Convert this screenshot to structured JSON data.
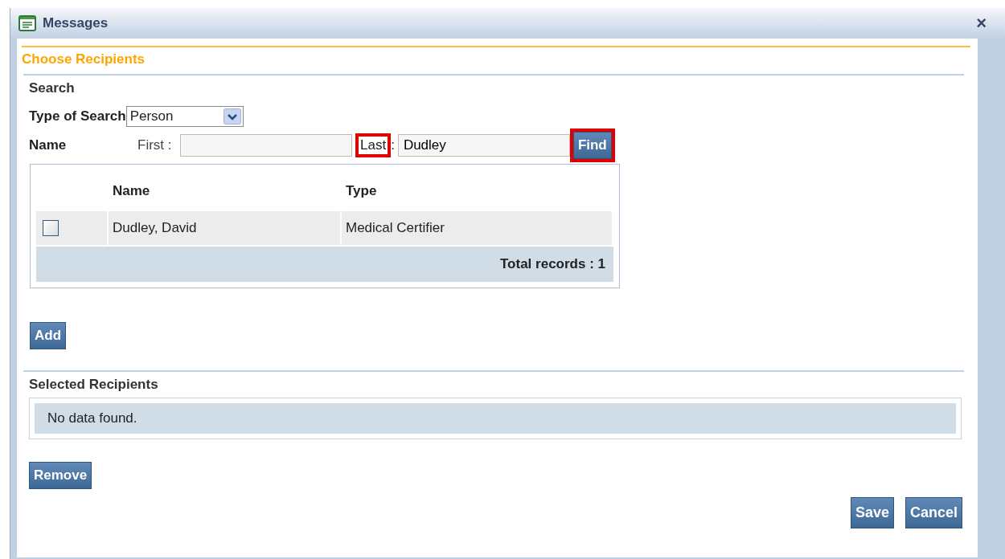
{
  "window": {
    "title": "Messages",
    "close": "×"
  },
  "section_title": "Choose Recipients",
  "search": {
    "heading": "Search",
    "type_label": "Type of Search",
    "type_value": "Person",
    "name_label": "Name",
    "first_label": "First :",
    "last_label": "Last",
    "last_colon": ":",
    "last_value": "Dudley",
    "last_highlighted": true,
    "find_button": "Find",
    "find_highlighted": true
  },
  "results": {
    "columns": [
      "Name",
      "Type"
    ],
    "rows": [
      {
        "checked": false,
        "name": "Dudley, David",
        "type": "Medical Certifier"
      }
    ],
    "total": "Total records : 1"
  },
  "add_button": "Add",
  "selected": {
    "heading": "Selected Recipients",
    "empty": "No data found."
  },
  "remove_button": "Remove",
  "buttons": [
    "Save",
    "Cancel"
  ]
}
